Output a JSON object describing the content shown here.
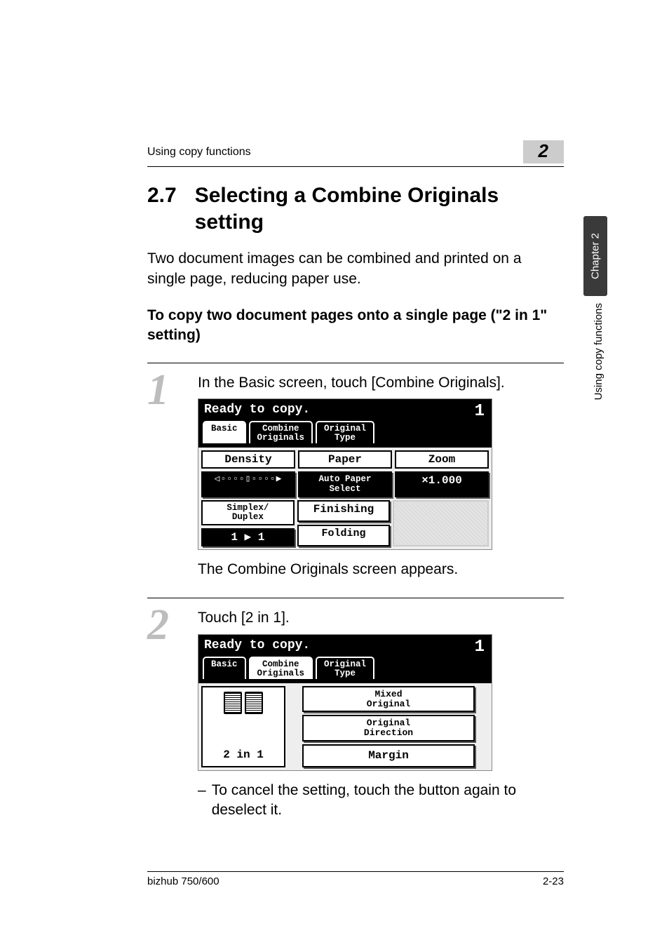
{
  "running_head": {
    "left": "Using copy functions",
    "num": "2"
  },
  "title": {
    "num": "2.7",
    "text": "Selecting a Combine Originals setting"
  },
  "intro": "Two document images can be combined and printed on a single page, reducing paper use.",
  "sub_heading": "To copy two document pages onto a single page (\"2 in 1\" setting)",
  "side_tab_dark": "Chapter 2",
  "side_tab_light": "Using copy functions",
  "steps": {
    "s1": {
      "num": "1",
      "text": "In the Basic screen, touch [Combine Originals].",
      "after": "The Combine Originals screen appears."
    },
    "s2": {
      "num": "2",
      "text": "Touch [2 in 1].",
      "dash": "To cancel the setting, touch the button again to deselect it."
    }
  },
  "lcd1": {
    "ready": "Ready to copy.",
    "count": "1",
    "tabs": {
      "basic": "Basic",
      "combine_l1": "Combine",
      "combine_l2": "Originals",
      "orig_l1": "Original",
      "orig_l2": "Type"
    },
    "row1": {
      "density": "Density",
      "paper": "Paper",
      "zoom": "Zoom"
    },
    "row2": {
      "density_icon": "◁▫▫▫▫▯▫▫▫▫▶",
      "paper_l1": "Auto Paper",
      "paper_l2": "Select",
      "zoom_val": "×1.000"
    },
    "row3": {
      "sd_l1": "Simplex/",
      "sd_l2": "Duplex",
      "finishing": "Finishing"
    },
    "row4": {
      "simplex_val": "1 ▶ 1",
      "folding": "Folding"
    }
  },
  "lcd2": {
    "ready": "Ready to copy.",
    "count": "1",
    "tabs": {
      "basic": "Basic",
      "combine_l1": "Combine",
      "combine_l2": "Originals",
      "orig_l1": "Original",
      "orig_l2": "Type"
    },
    "thumb_label": "2 in 1",
    "buttons": {
      "mixed_l1": "Mixed",
      "mixed_l2": "Original",
      "dir_l1": "Original",
      "dir_l2": "Direction",
      "margin": "Margin"
    }
  },
  "footer": {
    "left": "bizhub 750/600",
    "right": "2-23"
  }
}
